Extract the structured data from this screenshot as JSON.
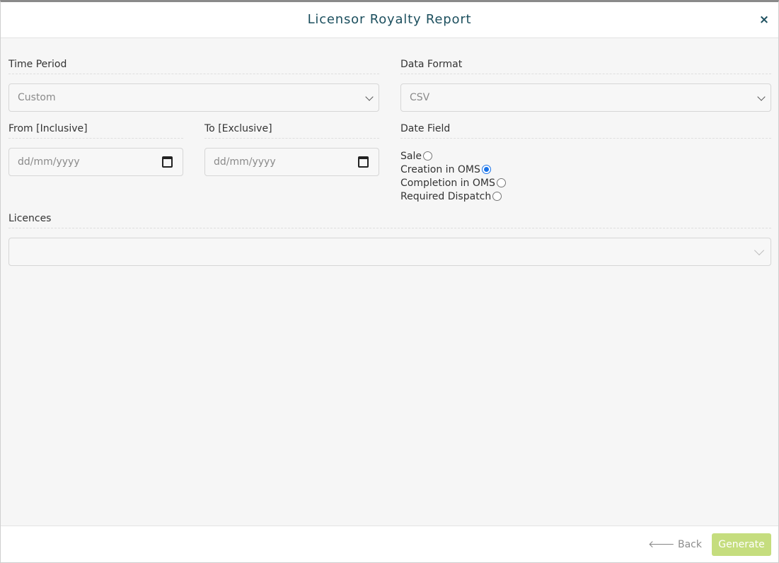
{
  "header": {
    "title": "Licensor Royalty Report",
    "close_glyph": "×"
  },
  "time_period": {
    "label": "Time Period",
    "selected": "Custom"
  },
  "data_format": {
    "label": "Data Format",
    "selected": "CSV"
  },
  "from": {
    "label": "From [Inclusive]",
    "placeholder": "dd/mm/yyyy"
  },
  "to": {
    "label": "To [Exclusive]",
    "placeholder": "dd/mm/yyyy"
  },
  "date_field": {
    "label": "Date Field",
    "options": [
      {
        "label": "Sale",
        "checked": false
      },
      {
        "label": "Creation in OMS",
        "checked": true
      },
      {
        "label": "Completion in OMS",
        "checked": false
      },
      {
        "label": "Required Dispatch",
        "checked": false
      }
    ]
  },
  "licences": {
    "label": "Licences",
    "value": ""
  },
  "footer": {
    "back_label": "Back",
    "back_icon": "arrow-left-icon",
    "generate_label": "Generate"
  },
  "colors": {
    "accent": "#1c4f5e",
    "generate_bg": "#c5dd7e",
    "radio_checked": "#1a73e8"
  }
}
